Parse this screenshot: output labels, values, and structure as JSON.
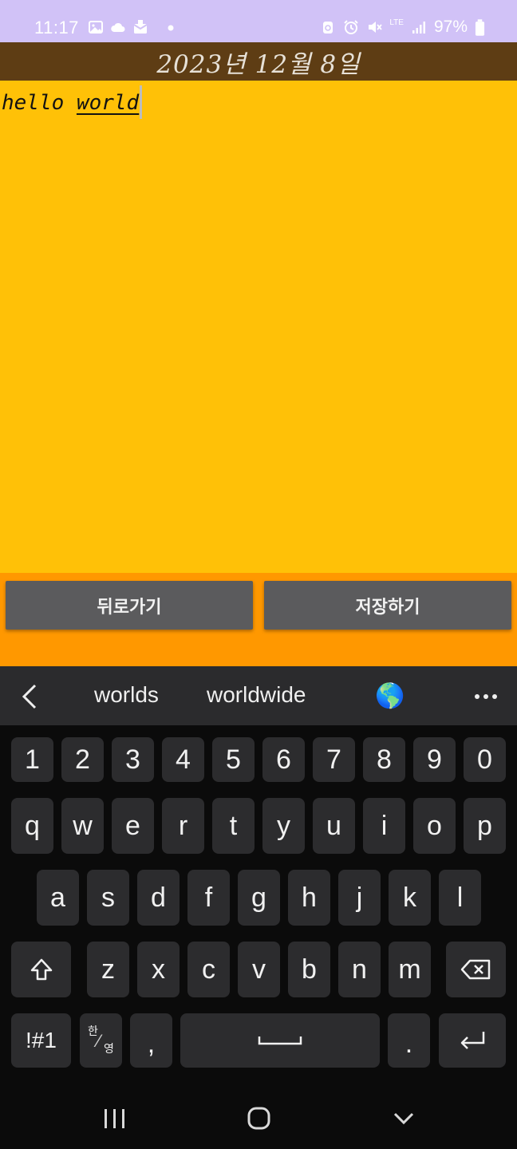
{
  "status_bar": {
    "time": "11:17",
    "battery": "97%",
    "network": "LTE",
    "icons": [
      "gallery-icon",
      "cloud-icon",
      "mail-icon",
      "dot-icon",
      "sync-icon",
      "alarm-icon",
      "mute-icon",
      "signal-icon",
      "battery-icon"
    ]
  },
  "header": {
    "date": "2023년 12월 8일"
  },
  "note": {
    "word1": "hello",
    "word2": "world"
  },
  "buttons": {
    "back": "뒤로가기",
    "save": "저장하기"
  },
  "suggestions": {
    "first": "worlds",
    "second": "worldwide",
    "emoji": "🌎"
  },
  "keyboard": {
    "row_numbers": [
      "1",
      "2",
      "3",
      "4",
      "5",
      "6",
      "7",
      "8",
      "9",
      "0"
    ],
    "row1": [
      "q",
      "w",
      "e",
      "r",
      "t",
      "y",
      "u",
      "i",
      "o",
      "p"
    ],
    "row2": [
      "a",
      "s",
      "d",
      "f",
      "g",
      "h",
      "j",
      "k",
      "l"
    ],
    "row3": [
      "z",
      "x",
      "c",
      "v",
      "b",
      "n",
      "m"
    ],
    "symbols": "!#1",
    "lang_top": "한",
    "lang_bottom": "영",
    "comma": ",",
    "period": "."
  },
  "colors": {
    "status_bar": "#d1c2f7",
    "header": "#5e3d14",
    "note_bg": "#ffc107",
    "button_bar": "#ff9800",
    "button": "#5b5b5d",
    "keyboard_bg": "#0b0b0b",
    "key": "#2c2c2e"
  }
}
